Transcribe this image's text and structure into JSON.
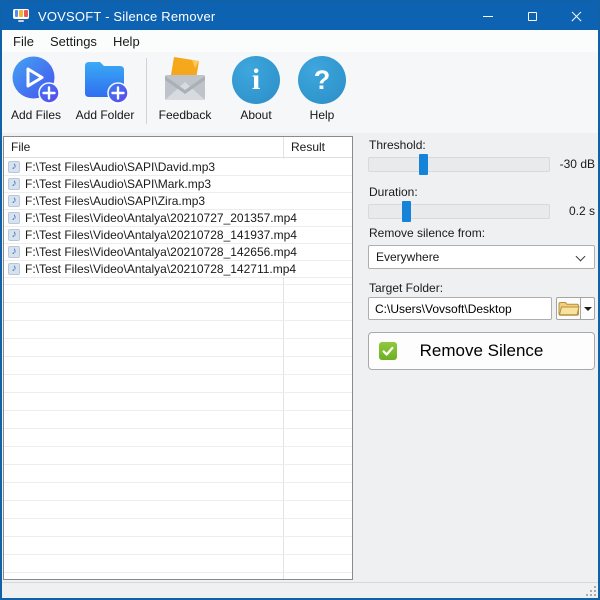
{
  "window": {
    "title": "VOVSOFT - Silence Remover"
  },
  "menu": {
    "items": [
      "File",
      "Settings",
      "Help"
    ]
  },
  "toolbar": {
    "buttons": [
      {
        "label": "Add Files",
        "icon": "play-plus-icon"
      },
      {
        "label": "Add Folder",
        "icon": "folder-plus-icon"
      },
      {
        "label": "Feedback",
        "icon": "envelope-icon"
      },
      {
        "label": "About",
        "icon": "info-icon",
        "glyph": "i"
      },
      {
        "label": "Help",
        "icon": "question-icon",
        "glyph": "?"
      }
    ]
  },
  "file_list": {
    "columns": {
      "file": "File",
      "result": "Result"
    },
    "row_icon": "music-note-icon",
    "note_glyph": "♪",
    "rows": [
      {
        "file": "F:\\Test Files\\Audio\\SAPI\\David.mp3",
        "result": ""
      },
      {
        "file": "F:\\Test Files\\Audio\\SAPI\\Mark.mp3",
        "result": ""
      },
      {
        "file": "F:\\Test Files\\Audio\\SAPI\\Zira.mp3",
        "result": ""
      },
      {
        "file": "F:\\Test Files\\Video\\Antalya\\20210727_201357.mp4",
        "result": ""
      },
      {
        "file": "F:\\Test Files\\Video\\Antalya\\20210728_141937.mp4",
        "result": ""
      },
      {
        "file": "F:\\Test Files\\Video\\Antalya\\20210728_142656.mp4",
        "result": ""
      },
      {
        "file": "F:\\Test Files\\Video\\Antalya\\20210728_142711.mp4",
        "result": ""
      }
    ]
  },
  "panel": {
    "threshold": {
      "label": "Threshold:",
      "value": "-30 dB",
      "fraction": 0.3
    },
    "duration": {
      "label": "Duration:",
      "value": "0.2 s",
      "fraction": 0.21
    },
    "remove_from": {
      "label": "Remove silence from:",
      "selected": "Everywhere"
    },
    "target_folder": {
      "label": "Target Folder:",
      "value": "C:\\Users\\Vovsoft\\Desktop"
    },
    "action_button": {
      "label": "Remove Silence"
    }
  },
  "colors": {
    "titlebar": "#0d63b2",
    "accent_blue": "#1583d7",
    "toolbar_icon_blue": "#2d9ad2",
    "checkbox_green": "#7cb32b",
    "folder_yellow": "#f1cf7e"
  }
}
